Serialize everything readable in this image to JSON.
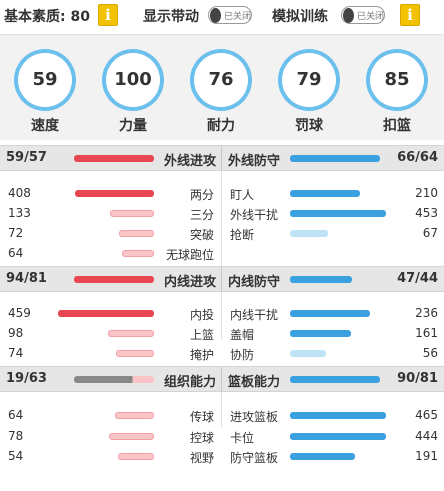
{
  "top": {
    "base_quality_label": "基本素质: 80",
    "show_dribble_label": "显示带动",
    "show_dribble_toggle": "已关闭",
    "sim_training_label": "模拟训练",
    "sim_training_toggle": "已关闭",
    "info_glyph": "i"
  },
  "circles": [
    {
      "value": "59",
      "label": "速度"
    },
    {
      "value": "100",
      "label": "力量"
    },
    {
      "value": "76",
      "label": "耐力"
    },
    {
      "value": "79",
      "label": "罚球"
    },
    {
      "value": "85",
      "label": "扣篮"
    }
  ],
  "sections": [
    {
      "left_score": "59/57",
      "left_title": "外线进攻",
      "left_fill": 1.0,
      "right_title": "外线防守",
      "right_score": "66/64",
      "right_fill": 1.0,
      "left_rows": [
        {
          "num": "408",
          "name": "两分",
          "level": 0.82
        },
        {
          "num": "133",
          "name": "三分",
          "level": 0.46
        },
        {
          "num": "72",
          "name": "突破",
          "level": 0.36
        },
        {
          "num": "64",
          "name": "无球跑位",
          "level": 0.33
        }
      ],
      "right_rows": [
        {
          "num": "210",
          "name": "盯人",
          "level": 0.73
        },
        {
          "num": "453",
          "name": "外线干扰",
          "level": 1.0
        },
        {
          "num": "67",
          "name": "抢断",
          "level": 0.4
        }
      ]
    },
    {
      "left_score": "94/81",
      "left_title": "内线进攻",
      "left_fill": 1.0,
      "right_title": "内线防守",
      "right_score": "47/44",
      "right_fill": 0.69,
      "left_rows": [
        {
          "num": "459",
          "name": "内投",
          "level": 1.0
        },
        {
          "num": "98",
          "name": "上篮",
          "level": 0.48
        },
        {
          "num": "74",
          "name": "掩护",
          "level": 0.4
        }
      ],
      "right_rows": [
        {
          "num": "236",
          "name": "内线干扰",
          "level": 0.83
        },
        {
          "num": "161",
          "name": "盖帽",
          "level": 0.64
        },
        {
          "num": "56",
          "name": "协防",
          "level": 0.38
        }
      ]
    },
    {
      "left_score": "19/63",
      "left_title": "组织能力",
      "left_fill": 0.27,
      "right_title": "篮板能力",
      "right_score": "90/81",
      "right_fill": 1.0,
      "left_rows": [
        {
          "num": "64",
          "name": "传球",
          "level": 0.41
        },
        {
          "num": "78",
          "name": "控球",
          "level": 0.47
        },
        {
          "num": "54",
          "name": "视野",
          "level": 0.38
        }
      ],
      "right_rows": [
        {
          "num": "465",
          "name": "进攻篮板",
          "level": 1.0
        },
        {
          "num": "444",
          "name": "卡位",
          "level": 1.0
        },
        {
          "num": "191",
          "name": "防守篮板",
          "level": 0.68
        }
      ]
    }
  ],
  "colors": {
    "attack_red": "#e84651",
    "attack_pink": "#fbc5c8",
    "defense_blue": "#3aa0e0",
    "defense_light": "#bfe3f6",
    "header_grey": "#888888",
    "ring_blue": "#6cc0ee",
    "info_yellow": "#f2c200"
  }
}
